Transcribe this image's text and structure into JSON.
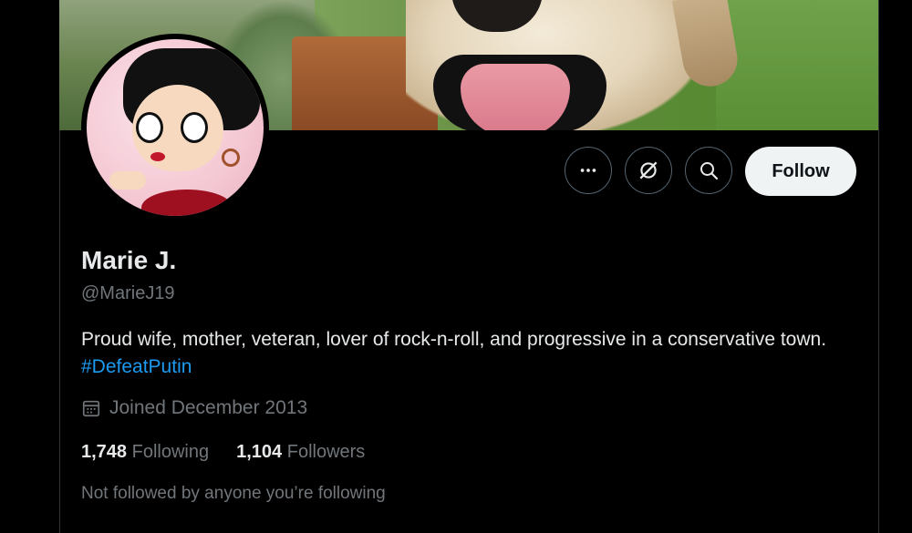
{
  "profile": {
    "name": "Marie J.",
    "handle": "@MarieJ19",
    "bio_text": "Proud wife, mother, veteran, lover of rock-n-roll, and progressive in a conservative town. ",
    "bio_hashtag": "#DefeatPutin",
    "joined": "Joined December 2013",
    "following_count": "1,748",
    "following_label": "Following",
    "followers_count": "1,104",
    "followers_label": "Followers",
    "social_context": "Not followed by anyone you’re following"
  },
  "actions": {
    "follow_label": "Follow",
    "icons": [
      "more-icon",
      "grok-icon",
      "search-icon"
    ]
  },
  "colors": {
    "background": "#000000",
    "text": "#e7e9ea",
    "muted": "#71767b",
    "link": "#1d9bf0",
    "follow_button_bg": "#eff3f4"
  }
}
